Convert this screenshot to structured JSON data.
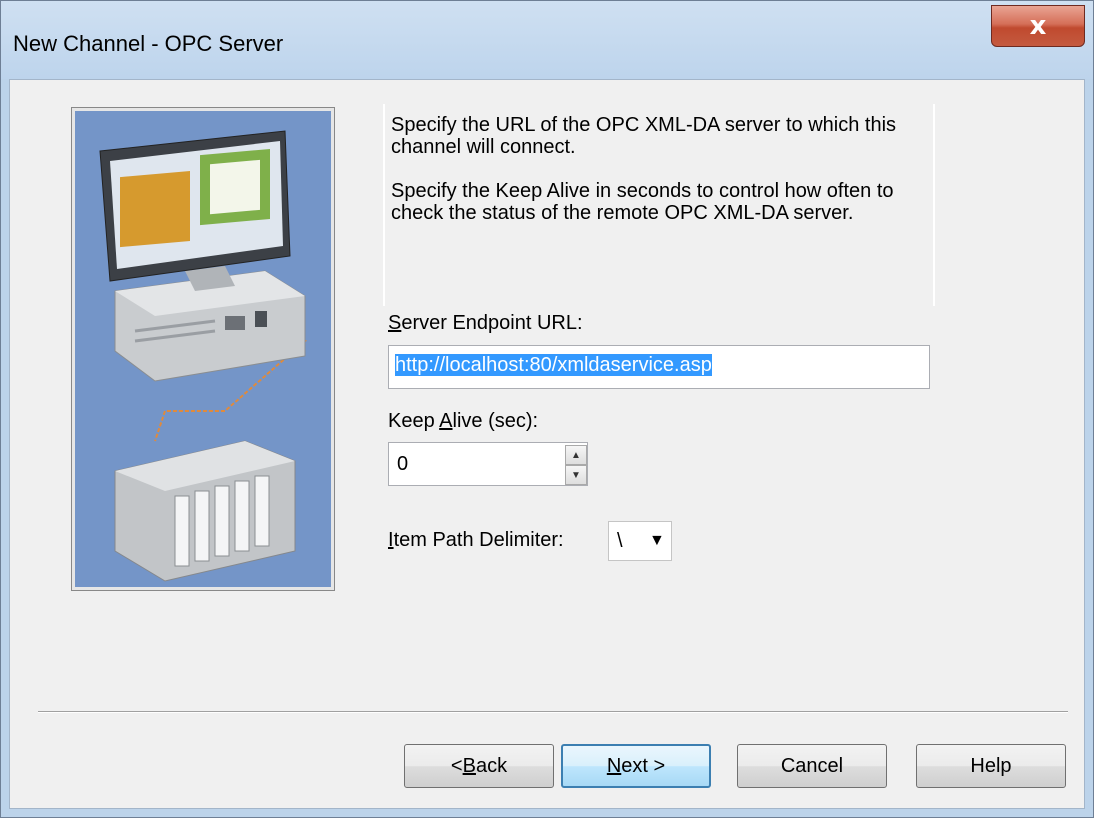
{
  "window": {
    "title": "New Channel - OPC Server",
    "close_label": "x"
  },
  "info": {
    "paragraph1": "Specify the URL of the OPC XML-DA server to which this channel will connect.",
    "paragraph2": "Specify the Keep Alive in seconds to control how often to check the status of the remote OPC XML-DA server."
  },
  "fields": {
    "url": {
      "label_ul": "S",
      "label_rest": "erver Endpoint URL:",
      "value": "http://localhost:80/xmldaservice.asp"
    },
    "keep_alive": {
      "label_pre": "Keep ",
      "label_ul": "A",
      "label_rest": "live (sec):",
      "value": "0"
    },
    "delimiter": {
      "label_ul": "I",
      "label_rest": "tem Path Delimiter:",
      "value": "\\"
    }
  },
  "buttons": {
    "back": {
      "pre": "< ",
      "ul": "B",
      "rest": "ack"
    },
    "next": {
      "ul": "N",
      "rest": "ext >"
    },
    "cancel": "Cancel",
    "help": "Help"
  },
  "icons": {
    "close": "close-icon",
    "spin_up": "spin-up-icon",
    "spin_down": "spin-down-icon",
    "dropdown": "chevron-down-icon"
  }
}
